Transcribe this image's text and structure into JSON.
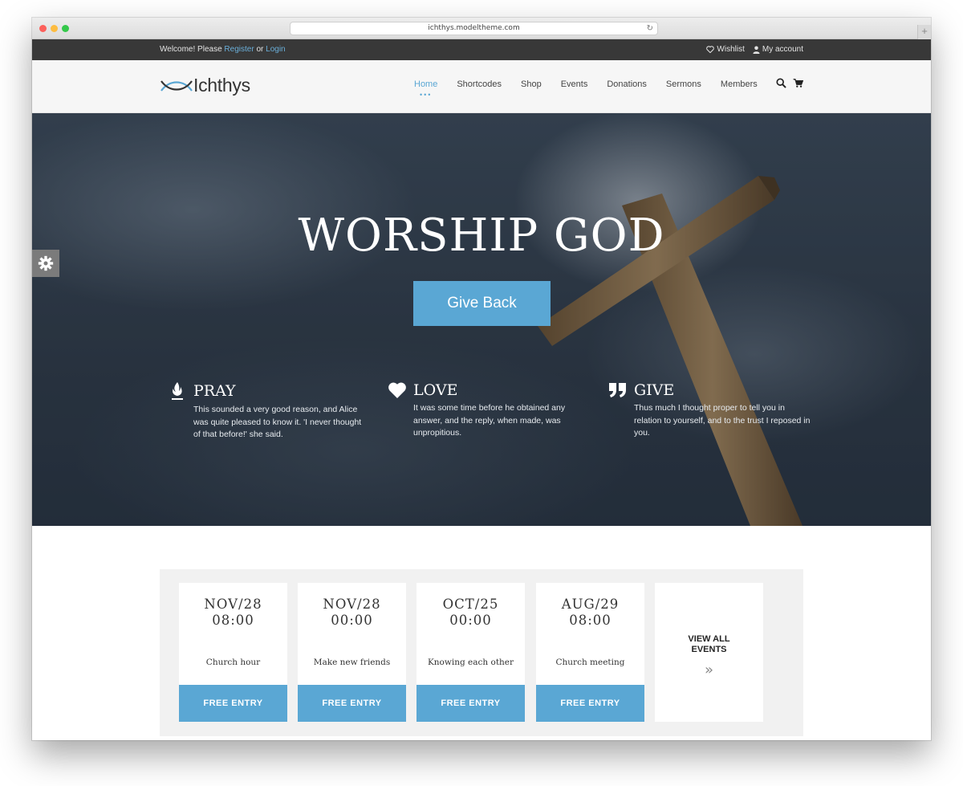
{
  "browser": {
    "url": "ichthys.modeltheme.com"
  },
  "topbar": {
    "welcome_prefix": "Welcome! Please",
    "register": "Register",
    "or": "or",
    "login": "Login",
    "wishlist": "Wishlist",
    "account": "My account"
  },
  "header": {
    "logo_text": "Ichthys",
    "nav": [
      "Home",
      "Shortcodes",
      "Shop",
      "Events",
      "Donations",
      "Sermons",
      "Members"
    ],
    "active_index": 0
  },
  "hero": {
    "title": "WORSHIP GOD",
    "button": "Give Back",
    "features": [
      {
        "icon": "flame-icon",
        "title": "PRAY",
        "text": "This sounded a very good reason, and Alice was quite pleased to know it. 'I never thought of that before!' she said."
      },
      {
        "icon": "heart-icon",
        "title": "LOVE",
        "text": "It was some time before he obtained any answer, and the reply, when made, was unpropitious."
      },
      {
        "icon": "quote-icon",
        "title": "GIVE",
        "text": "Thus much I thought proper to tell you in relation to yourself, and to the trust I reposed in you."
      }
    ]
  },
  "events": {
    "items": [
      {
        "date": "NOV/28",
        "time": "08:00",
        "name": "Church hour",
        "button": "FREE ENTRY"
      },
      {
        "date": "NOV/28",
        "time": "00:00",
        "name": "Make new friends",
        "button": "FREE ENTRY"
      },
      {
        "date": "OCT/25",
        "time": "00:00",
        "name": "Knowing each other",
        "button": "FREE ENTRY"
      },
      {
        "date": "AUG/29",
        "time": "08:00",
        "name": "Church meeting",
        "button": "FREE ENTRY"
      }
    ],
    "view_all": "VIEW ALL EVENTS"
  },
  "colors": {
    "accent": "#5aa7d4",
    "topbar": "#383838"
  }
}
